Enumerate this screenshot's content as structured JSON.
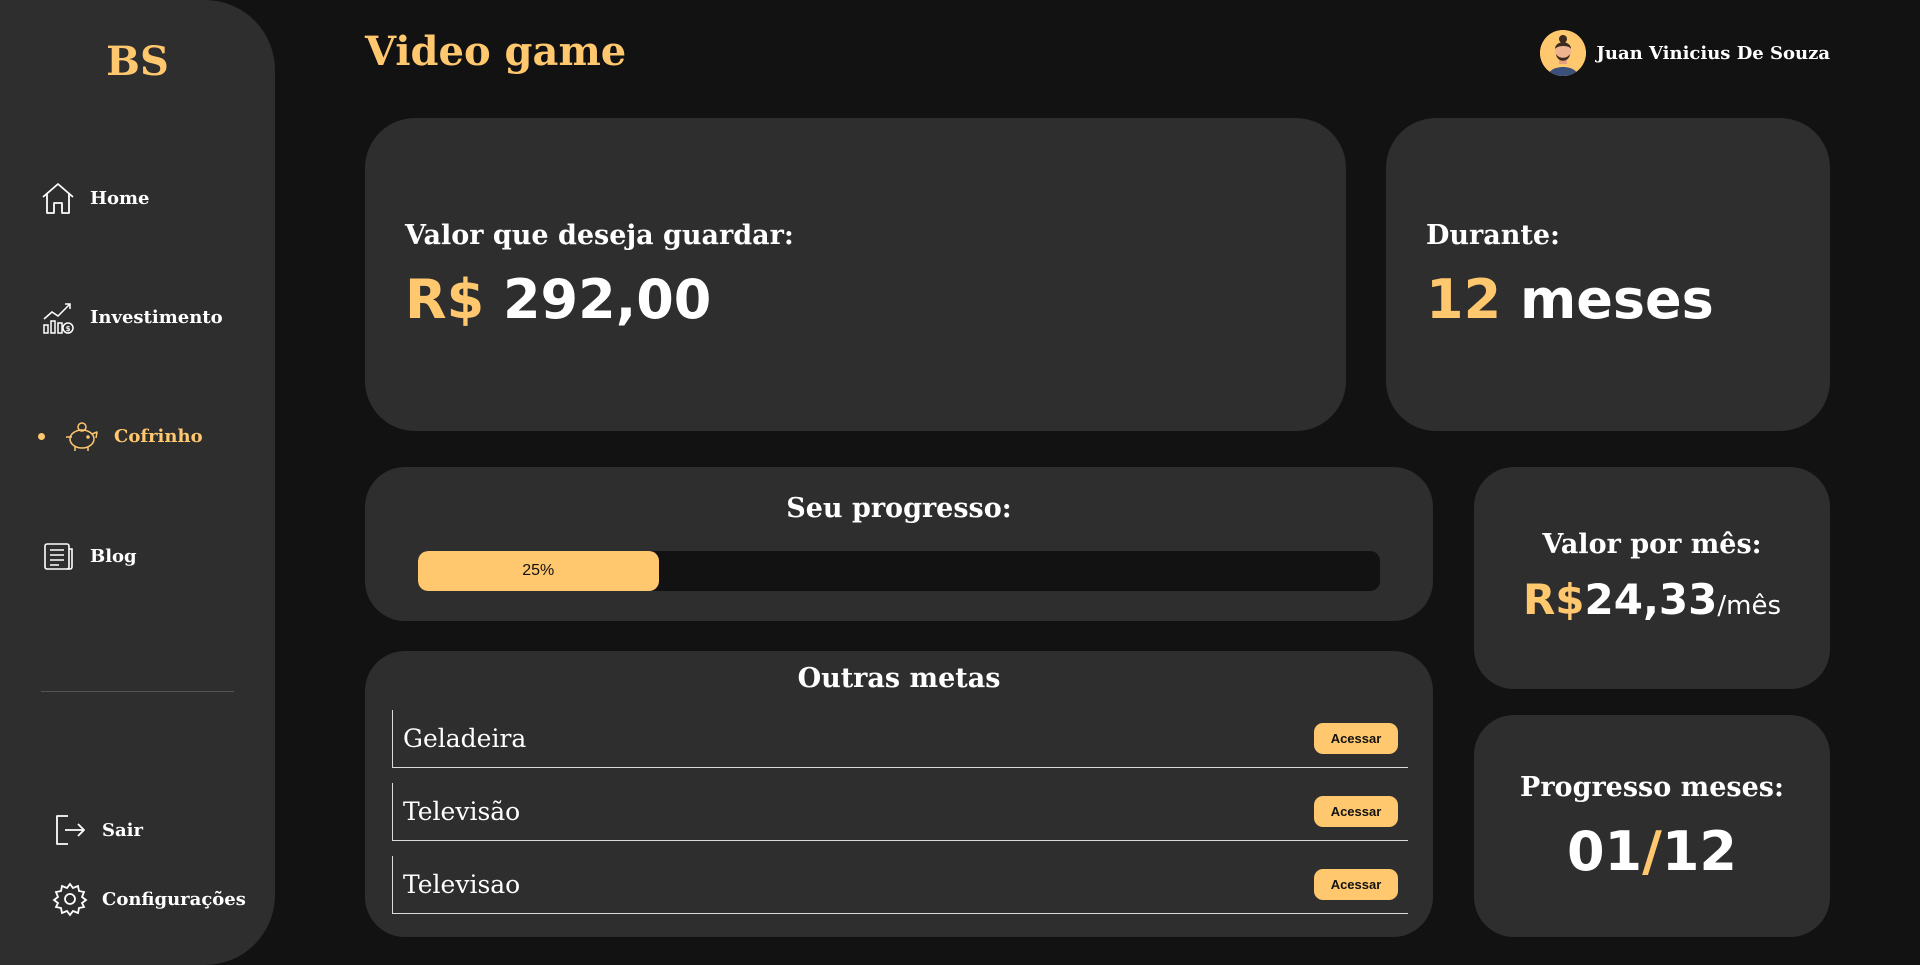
{
  "app": {
    "logo": "BS"
  },
  "sidebar": {
    "items": [
      {
        "label": "Home",
        "icon": "home-icon",
        "active": false
      },
      {
        "label": "Investimento",
        "icon": "chart-growth-icon",
        "active": false
      },
      {
        "label": "Cofrinho",
        "icon": "piggy-bank-icon",
        "active": true
      },
      {
        "label": "Blog",
        "icon": "newspaper-icon",
        "active": false
      }
    ],
    "bottom": [
      {
        "label": "Sair",
        "icon": "logout-icon"
      },
      {
        "label": "Configurações",
        "icon": "gear-icon"
      }
    ]
  },
  "header": {
    "title": "Video game",
    "user_name": "Juan Vinicius De Souza"
  },
  "summary": {
    "amount_label": "Valor que deseja guardar:",
    "amount_currency": "R$",
    "amount_value": "292,00",
    "duration_label": "Durante:",
    "duration_number": "12",
    "duration_unit": "meses"
  },
  "progress": {
    "title": "Seu progresso:",
    "percent_text": "25%",
    "fraction": 0.25
  },
  "monthly": {
    "label": "Valor por mês:",
    "currency": "R$",
    "value": "24,33",
    "suffix": "/mês"
  },
  "months_progress": {
    "label": "Progresso meses:",
    "current": "01",
    "separator": "/",
    "total": "12"
  },
  "other_goals": {
    "title": "Outras metas",
    "button_label": "Acessar",
    "items": [
      {
        "name": "Geladeira"
      },
      {
        "name": "Televisão"
      },
      {
        "name": "Televisao"
      }
    ]
  },
  "colors": {
    "accent": "#ffc76e",
    "background": "#121212",
    "card": "#2e2e2e"
  }
}
